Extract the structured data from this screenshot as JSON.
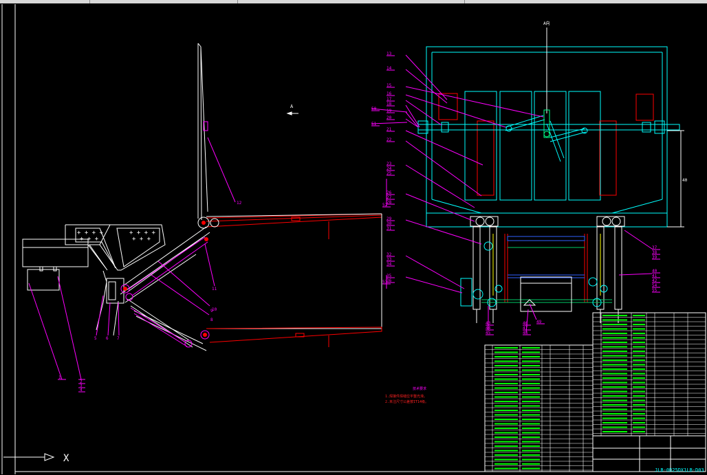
{
  "drawing": {
    "view_marker_left": "A",
    "view_marker_right": "A向",
    "axis_x_label": "X",
    "dimension_label": "40",
    "drawing_number": "JLB-0D25DX1LB-D03",
    "part_labels_left": [
      "1",
      "2",
      "3",
      "4",
      "5",
      "6",
      "7",
      "8",
      "9",
      "10",
      "11",
      "12"
    ],
    "part_labels_right": [
      "13",
      "14",
      "15",
      "16",
      "17",
      "18",
      "19",
      "20",
      "21",
      "22",
      "23",
      "24",
      "25",
      "26",
      "27",
      "28",
      "29",
      "30",
      "31",
      "32",
      "33",
      "34",
      "35",
      "36",
      "37",
      "38",
      "39",
      "40",
      "41",
      "42",
      "43",
      "44",
      "45",
      "46",
      "47",
      "48",
      "49",
      "50",
      "51",
      "52",
      "53",
      "54",
      "55"
    ],
    "notes_title": "技术要求",
    "notes": [
      "1.焊接件焊缝应平整光滑。",
      "2.未注尺寸公差按IT14级。"
    ]
  },
  "colors": {
    "outline": "#ffffff",
    "frame": "#00ffff",
    "leader": "#ff00ff",
    "mechanism": "#ff0000",
    "hydraulic": "#ffff00",
    "shaft": "#00cc66",
    "table_line": "#ffffff",
    "table_text": "#00ff00"
  }
}
